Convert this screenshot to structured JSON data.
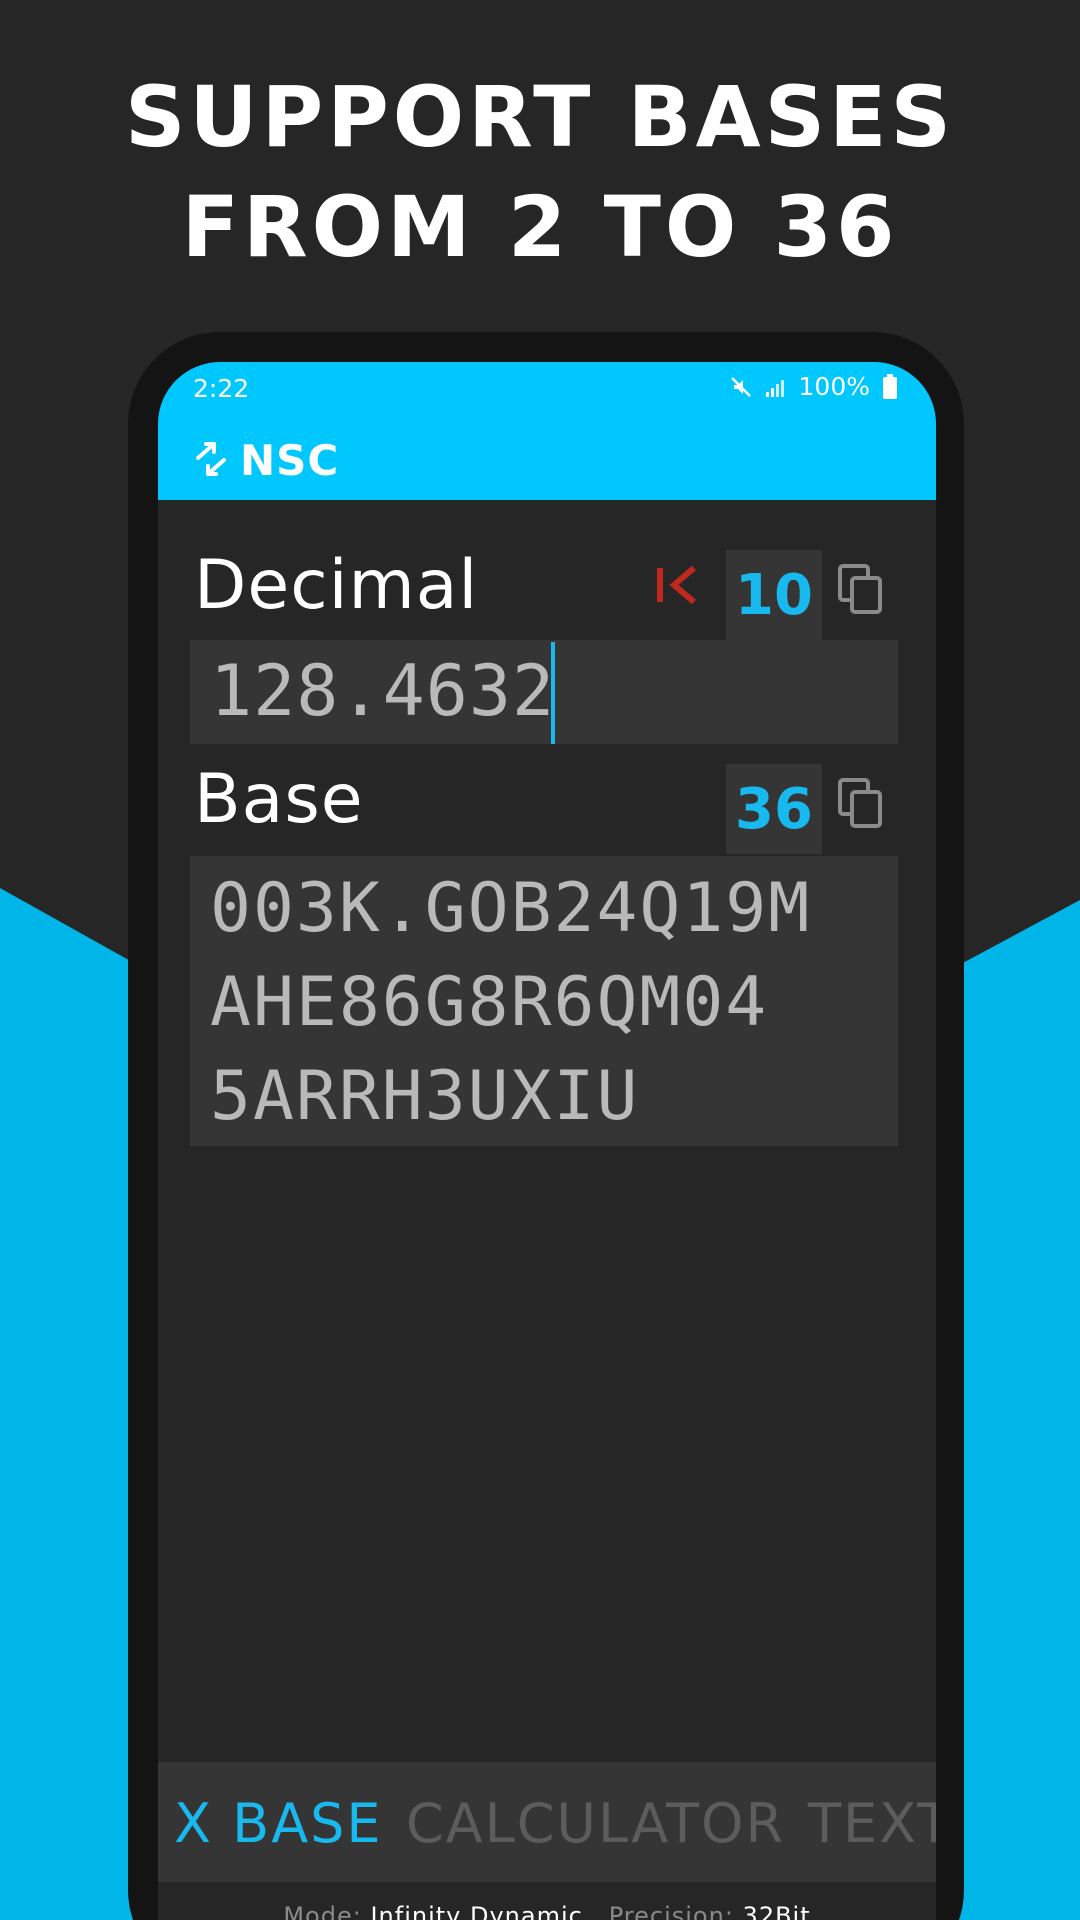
{
  "headline": {
    "line1": "SUPPORT BASES",
    "line2": "FROM 2 TO 36"
  },
  "status_bar": {
    "time": "2:22",
    "battery": "100%",
    "icons": [
      "mute-icon",
      "signal-icon",
      "battery-icon"
    ]
  },
  "app_bar": {
    "title": "NSC",
    "logo_icon": "swap-arrows-icon"
  },
  "decimal_field": {
    "label": "Decimal",
    "base": "10",
    "value": "128.4632",
    "clear_icon": "clear-left-icon",
    "copy_icon": "copy-icon"
  },
  "base_field": {
    "label": "Base",
    "base": "36",
    "value": "003K.GOB24Q19M\nAHE86G8R6QM04\n5ARRH3UXIU",
    "copy_icon": "copy-icon"
  },
  "tabs": [
    {
      "label": "X BASE",
      "active": true
    },
    {
      "label": "CALCULATOR",
      "active": false
    },
    {
      "label": "TEXT",
      "active": false
    }
  ],
  "footer": {
    "mode_label": "Mode:",
    "mode_value": "Infinity Dynamic",
    "precision_label": "Precision:",
    "precision_value": "32Bit"
  },
  "colors": {
    "accent": "#00c8ff",
    "background": "#262626",
    "field_bg": "#353535",
    "base_number": "#18b9ee",
    "clear_red": "#c0281e",
    "inactive_tab": "#5c5c5c"
  }
}
